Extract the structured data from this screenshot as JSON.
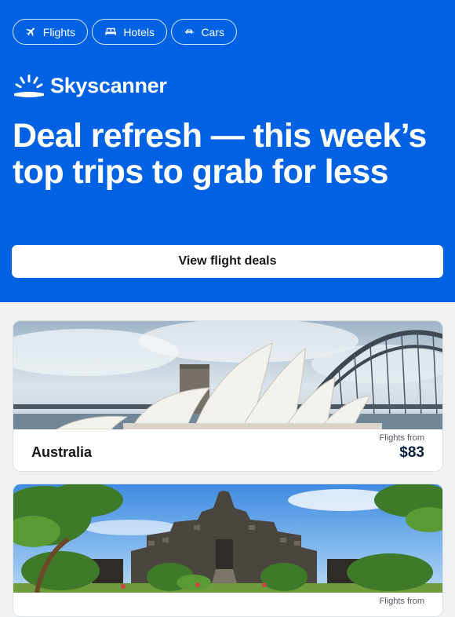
{
  "nav": {
    "pills": [
      {
        "label": "Flights",
        "icon": "plane-icon"
      },
      {
        "label": "Hotels",
        "icon": "bed-icon"
      },
      {
        "label": "Cars",
        "icon": "car-icon"
      }
    ]
  },
  "brand": {
    "name": "Skyscanner"
  },
  "hero": {
    "headline": "Deal refresh — this week’s top trips to grab for less",
    "cta_label": "View flight deals"
  },
  "deals": [
    {
      "destination": "Australia",
      "from_label": "Flights from",
      "price": "$83",
      "image": "sydney-opera-house-photo"
    },
    {
      "destination": "",
      "from_label": "Flights from",
      "price": "",
      "image": "bali-temple-photo"
    }
  ],
  "colors": {
    "brand_blue": "#0062e3",
    "price_navy": "#05203c"
  }
}
